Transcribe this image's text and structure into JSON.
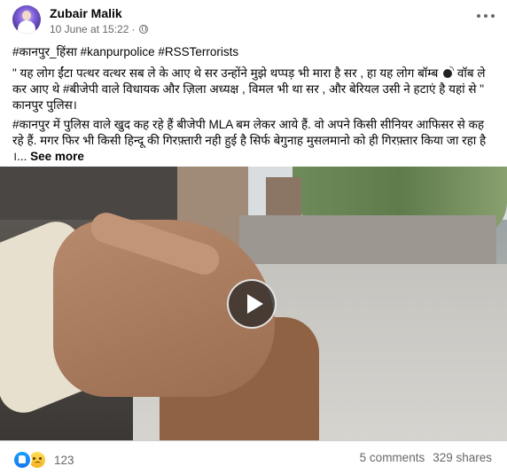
{
  "post": {
    "author": "Zubair Malik",
    "date": "10 June at 15:22",
    "separator": "·",
    "privacy_icon": "globe-icon",
    "hashtags": "#कानपुर_हिंसा #kanpurpolice #RSSTerrorists",
    "quote_part1": "\" यह लोग ईंटा पत्थर वत्थर सब ले के आए थे सर उन्होंने मुझे थप्पड़ भी मारा है सर , हा यह लोग बॉम्ब ",
    "quote_part2": " वॉब ले कर आए थे #बीजेपी वाले विधायक और ज़िला अध्यक्ष , विमल भी था सर , और बेरियल उसी ने हटाएं है यहां से \" कानपुर पुलिस।",
    "para2": "#कानपुर में पुलिस वाले खुद कह रहे हैं बीजेपी MLA बम लेकर आये हैं. वो अपने किसी सीनियर आफिसर से कह रहे हैं. मगर फिर भी किसी हिन्दू की गिरफ़्तारी नही हुई है सिर्फ बेगुनाह मुसलमानो को ही गिरफ़्तार किया जा रहा है ।...",
    "see_more": "See more"
  },
  "footer": {
    "reaction_count": "123",
    "comments": "5 comments",
    "shares": "329 shares"
  }
}
